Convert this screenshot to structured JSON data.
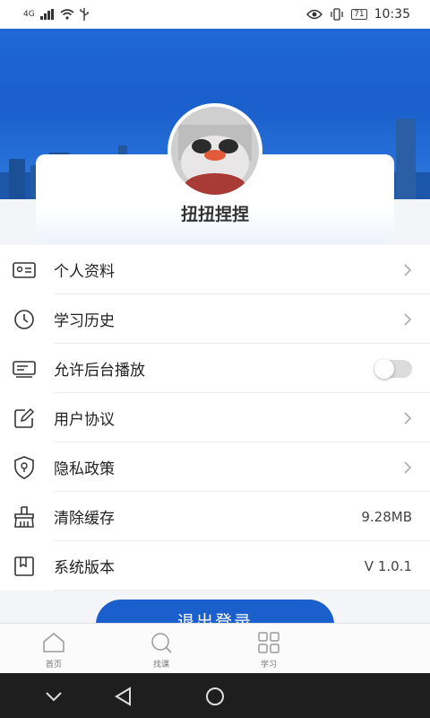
{
  "status_bar": {
    "network": "4G",
    "battery": "71",
    "time": "10:35",
    "icons": [
      "signal-icon",
      "wifi-icon",
      "usb-icon",
      "eye-icon",
      "vibrate-icon"
    ]
  },
  "profile": {
    "username": "扭扭捏捏"
  },
  "menu": {
    "items": [
      {
        "label": "个人资料",
        "icon": "id-card-icon",
        "trailing": "chevron"
      },
      {
        "label": "学习历史",
        "icon": "clock-icon",
        "trailing": "chevron"
      },
      {
        "label": "允许后台播放",
        "icon": "keyboard-icon",
        "trailing": "toggle",
        "toggle_on": false
      },
      {
        "label": "用户协议",
        "icon": "edit-icon",
        "trailing": "chevron"
      },
      {
        "label": "隐私政策",
        "icon": "shield-icon",
        "trailing": "chevron"
      },
      {
        "label": "清除缓存",
        "icon": "broom-icon",
        "trailing": "value",
        "value": "9.28MB"
      },
      {
        "label": "系统版本",
        "icon": "bookmark-icon",
        "trailing": "value",
        "value": "V 1.0.1"
      }
    ]
  },
  "logout": {
    "label": "退出登录"
  },
  "bottom_nav": {
    "items": [
      {
        "label": "首页",
        "icon": "home-icon"
      },
      {
        "label": "找课",
        "icon": "search-icon"
      },
      {
        "label": "学习",
        "icon": "grid-icon"
      }
    ]
  },
  "colors": {
    "accent": "#1a5fcc",
    "header_blue": "#1f68d6",
    "divider": "#ececec"
  }
}
